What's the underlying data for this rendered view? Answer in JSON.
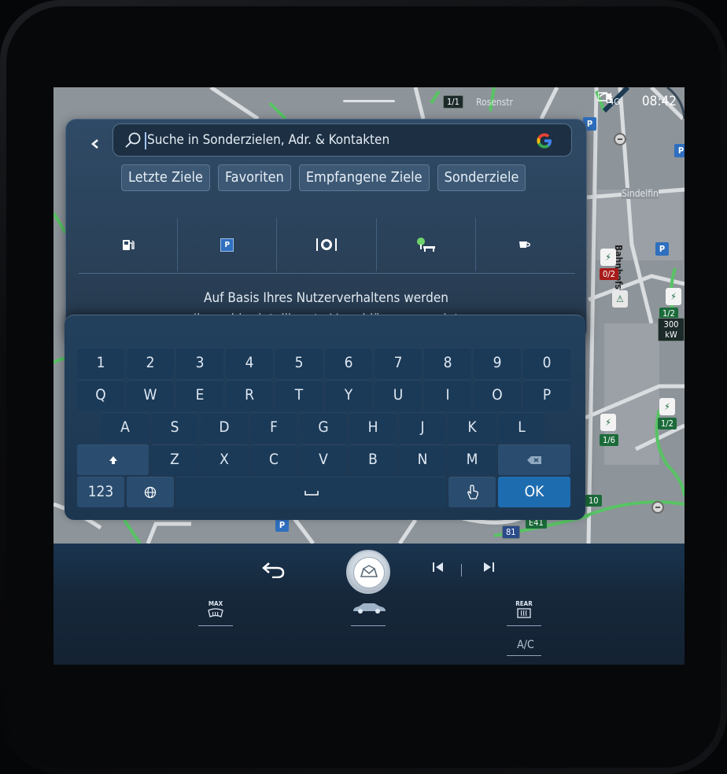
{
  "status": {
    "time": "08:42",
    "network": "4G",
    "street_name": "Rosenstr",
    "road_badge": "1/1"
  },
  "map": {
    "labels": {
      "town": "Sindelfin",
      "street_vertical": "Bahnhofstr.",
      "road_e41": "E41",
      "road_81": "81"
    },
    "badges": {
      "red1": "0/2",
      "g1": "1/2",
      "g1_power": "300 kW",
      "g2": "1/2",
      "g3": "1/6",
      "g4": "10"
    }
  },
  "search": {
    "placeholder": "Suche in Sonderzielen, Adr. & Kontakten",
    "value": "",
    "tabs": [
      "Letzte Ziele",
      "Favoriten",
      "Empfangene Ziele",
      "Sonderziele"
    ],
    "categories": [
      "fuel-station-icon",
      "parking-icon",
      "restaurant-icon",
      "rest-area-icon",
      "cafe-icon"
    ],
    "parking_letter": "P",
    "suggestion_line1": "Auf Basis Ihres Nutzerverhaltens werden",
    "suggestion_line2": "Ihnen hier intelligente Vorschläge angezeigt"
  },
  "keyboard": {
    "row1": [
      "1",
      "2",
      "3",
      "4",
      "5",
      "6",
      "7",
      "8",
      "9",
      "0"
    ],
    "row2": [
      "Q",
      "W",
      "E",
      "R",
      "T",
      "Y",
      "U",
      "I",
      "O",
      "P"
    ],
    "row3": [
      "A",
      "S",
      "D",
      "F",
      "G",
      "H",
      "J",
      "K",
      "L"
    ],
    "row4": [
      "Z",
      "X",
      "C",
      "V",
      "B",
      "N",
      "M"
    ],
    "num_label": "123",
    "ok_label": "OK"
  },
  "bottom": {
    "max_label": "MAX",
    "rear_label": "REAR",
    "ac_label": "A/C"
  },
  "colors": {
    "accent": "#1e6cb0",
    "panel": "#2f4a66",
    "keyboard": "#1b3a58",
    "map_bg": "#8b9298"
  }
}
